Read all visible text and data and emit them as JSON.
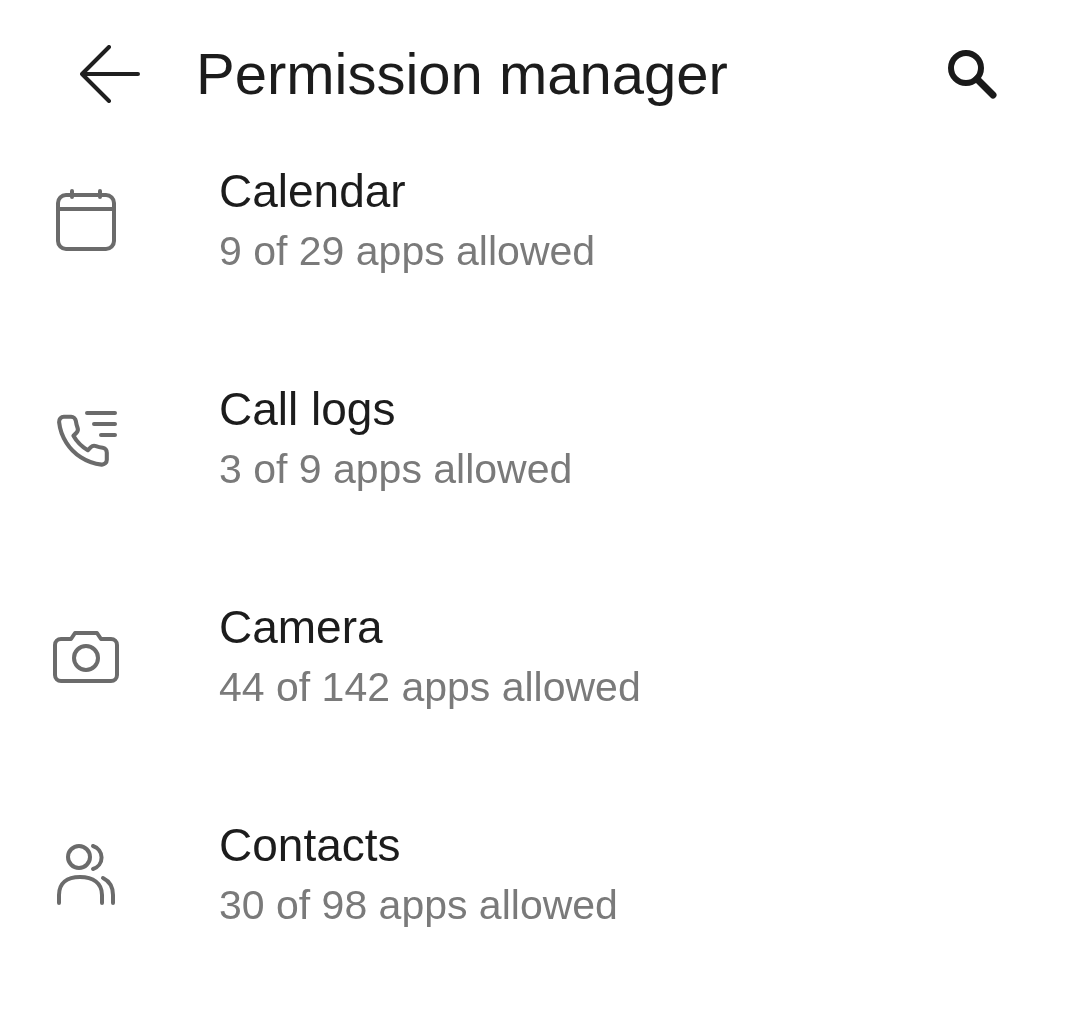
{
  "header": {
    "title": "Permission manager"
  },
  "permissions": [
    {
      "kind": "calendar",
      "name": "Calendar",
      "summary": "9 of 29 apps allowed"
    },
    {
      "kind": "call_logs",
      "name": "Call logs",
      "summary": "3 of 9 apps allowed"
    },
    {
      "kind": "camera",
      "name": "Camera",
      "summary": "44 of 142 apps allowed"
    },
    {
      "kind": "contacts",
      "name": "Contacts",
      "summary": "30 of 98 apps allowed"
    }
  ]
}
